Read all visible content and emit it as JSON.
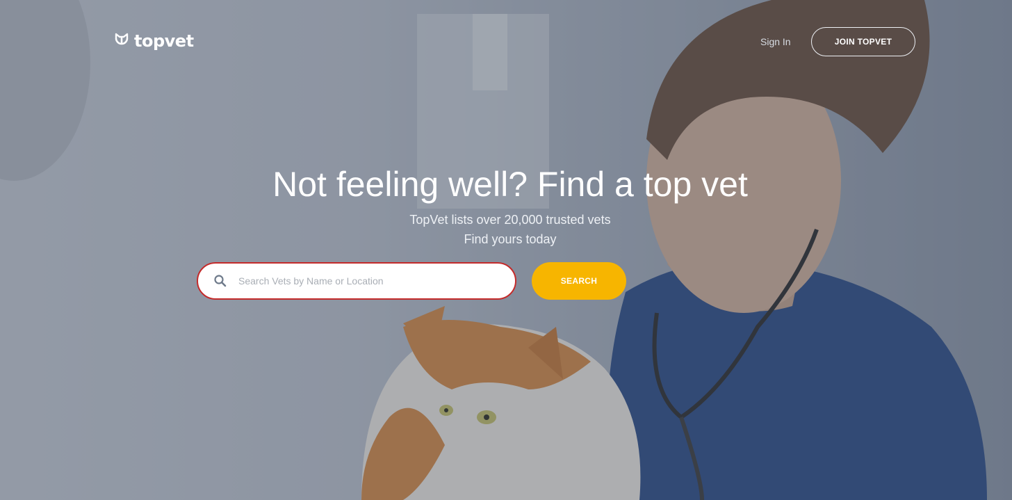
{
  "brand": {
    "name": "topvet",
    "logo_icon": "cat-head-icon"
  },
  "nav": {
    "signin_label": "Sign In",
    "join_label": "JOIN TOPVET"
  },
  "hero": {
    "headline": "Not feeling well? Find a top vet",
    "subline1": "TopVet lists over 20,000 trusted vets",
    "subline2": "Find yours today"
  },
  "search": {
    "placeholder": "Search Vets by Name or Location",
    "value": "",
    "button_label": "SEARCH",
    "icon": "search-icon"
  },
  "colors": {
    "accent": "#f7b500",
    "search_border": "#c42a2a",
    "text": "#ffffff"
  }
}
